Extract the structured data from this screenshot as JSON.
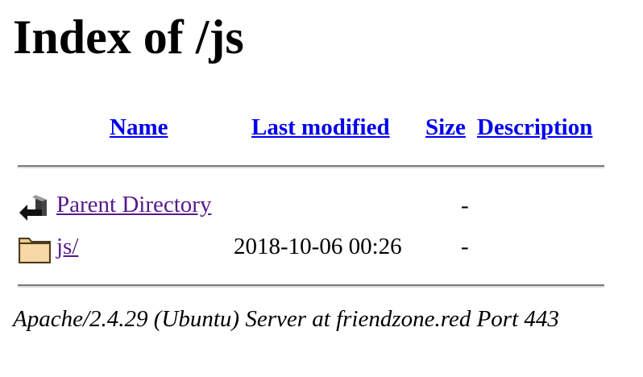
{
  "page": {
    "heading": "Index of /js"
  },
  "table": {
    "headers": {
      "name": "Name",
      "last_modified": "Last modified",
      "size": "Size",
      "description": "Description"
    },
    "rows": [
      {
        "icon": "back-arrow-icon",
        "name": "Parent Directory",
        "last_modified": "",
        "size": "-",
        "description": ""
      },
      {
        "icon": "folder-icon",
        "name": "js/",
        "last_modified": "2018-10-06 00:26",
        "size": "-",
        "description": ""
      }
    ]
  },
  "footer": {
    "server_signature": "Apache/2.4.29 (Ubuntu) Server at friendzone.red Port 443"
  },
  "colors": {
    "link": "#0000ee",
    "visited_link": "#551a8b",
    "rule_dark": "#7a7a7a",
    "rule_light": "#dcdcdc",
    "folder_fill": "#f2c98a"
  }
}
